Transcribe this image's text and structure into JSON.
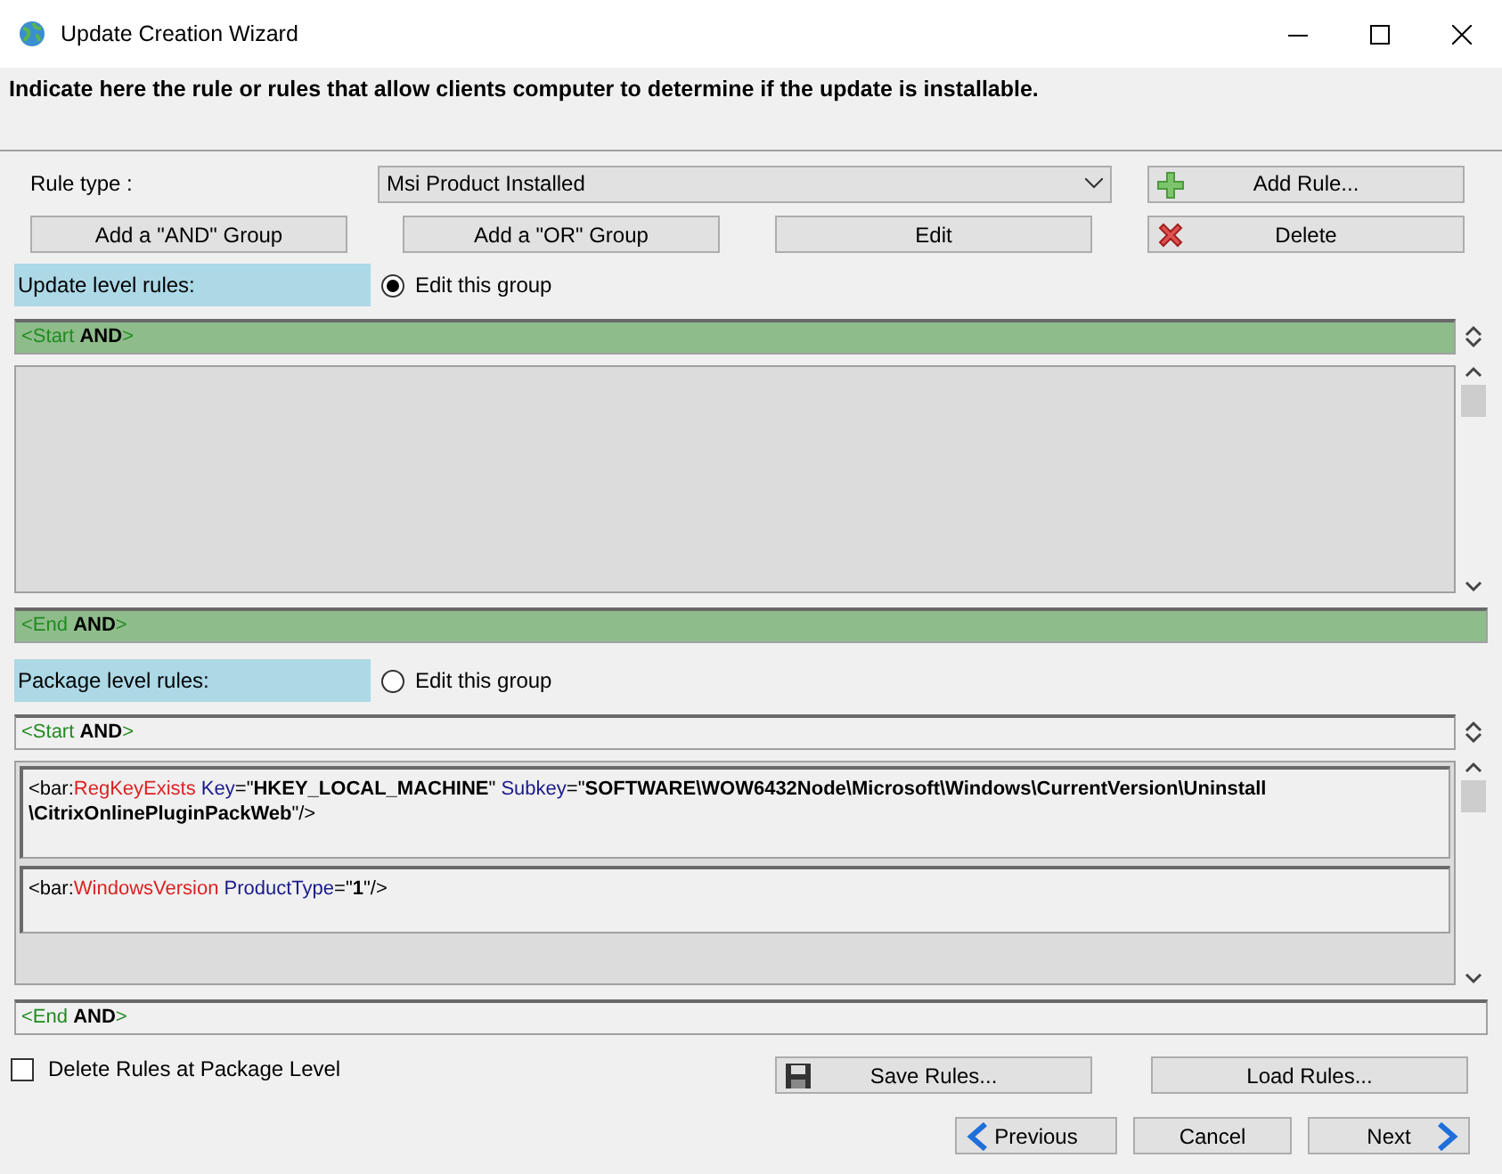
{
  "window": {
    "title": "Update Creation Wizard"
  },
  "instruction": "Indicate here the rule or rules that allow clients computer to determine if the update is installable.",
  "rule_type": {
    "label": "Rule type :",
    "value": "Msi Product Installed"
  },
  "buttons": [
    {
      "kind": "add",
      "label": "Add Rule..."
    },
    {
      "kind": "plain",
      "label": "Add a \"AND\" Group"
    },
    {
      "kind": "plain",
      "label": "Add a \"OR\" Group"
    },
    {
      "kind": "plain",
      "label": "Edit"
    },
    {
      "kind": "delete",
      "label": "Delete"
    }
  ],
  "groups": [
    {
      "label": "Update level rules:",
      "radio": "Edit this group",
      "selected": true,
      "start": [
        {
          "kind": "punct",
          "text": "<Start "
        },
        {
          "kind": "op",
          "text": "AND"
        },
        {
          "kind": "punct",
          "text": ">"
        }
      ],
      "end": [
        {
          "kind": "punct",
          "text": "<End "
        },
        {
          "kind": "op",
          "text": "AND"
        },
        {
          "kind": "punct",
          "text": ">"
        }
      ]
    },
    {
      "label": "Package level rules:",
      "radio": "Edit this group",
      "selected": false,
      "start": [
        {
          "kind": "punct",
          "text": "<Start "
        },
        {
          "kind": "op",
          "text": "AND"
        },
        {
          "kind": "punct",
          "text": ">"
        }
      ],
      "rules": [
        [
          {
            "kind": "plain",
            "text": "<bar:"
          },
          {
            "kind": "name",
            "text": "RegKeyExists"
          },
          {
            "kind": "attr",
            "text": " Key"
          },
          {
            "kind": "plain",
            "text": "=\""
          },
          {
            "kind": "value",
            "text": "HKEY_LOCAL_MACHINE"
          },
          {
            "kind": "plain",
            "text": "\""
          },
          {
            "kind": "attr",
            "text": " Subkey"
          },
          {
            "kind": "plain",
            "text": "=\""
          },
          {
            "kind": "value",
            "text": "SOFTWARE\\WOW6432Node\\Microsoft\\Windows\\CurrentVersion\\Uninstall"
          },
          {
            "kind": "break"
          },
          {
            "kind": "value",
            "text": "\\CitrixOnlinePluginPackWeb"
          },
          {
            "kind": "plain",
            "text": "\"/>"
          }
        ],
        [
          {
            "kind": "plain",
            "text": "<bar:"
          },
          {
            "kind": "name",
            "text": "WindowsVersion"
          },
          {
            "kind": "attr",
            "text": " ProductType"
          },
          {
            "kind": "plain",
            "text": "=\""
          },
          {
            "kind": "value",
            "text": "1"
          },
          {
            "kind": "plain",
            "text": "\"/>"
          }
        ]
      ],
      "end": [
        {
          "kind": "punct",
          "text": "<End "
        },
        {
          "kind": "op",
          "text": "AND"
        },
        {
          "kind": "punct",
          "text": ">"
        }
      ]
    }
  ],
  "delete_rules": {
    "label": "Delete Rules at Package Level",
    "checked": false
  },
  "file_buttons": [
    {
      "kind": "save",
      "label": "Save Rules..."
    },
    {
      "kind": "plain",
      "label": "Load Rules..."
    }
  ],
  "nav_buttons": [
    {
      "kind": "previous",
      "label": "Previous"
    },
    {
      "kind": "plain",
      "label": "Cancel"
    },
    {
      "kind": "next",
      "label": "Next"
    }
  ]
}
